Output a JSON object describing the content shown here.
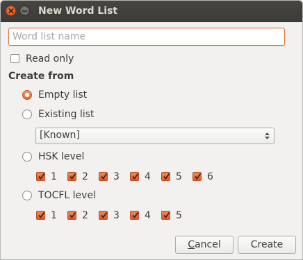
{
  "window": {
    "title": "New Word List"
  },
  "name_field": {
    "placeholder": "Word list name",
    "value": ""
  },
  "read_only": {
    "label": "Read only",
    "checked": false
  },
  "create_from": {
    "title": "Create from",
    "empty_list": {
      "label": "Empty list",
      "selected": true
    },
    "existing_list": {
      "label": "Existing list",
      "selected": false,
      "combo_value": "[Known]"
    },
    "hsk": {
      "label": "HSK level",
      "selected": false,
      "levels": [
        {
          "label": "1",
          "checked": true
        },
        {
          "label": "2",
          "checked": true
        },
        {
          "label": "3",
          "checked": true
        },
        {
          "label": "4",
          "checked": true
        },
        {
          "label": "5",
          "checked": true
        },
        {
          "label": "6",
          "checked": true
        }
      ]
    },
    "tocfl": {
      "label": "TOCFL level",
      "selected": false,
      "levels": [
        {
          "label": "1",
          "checked": true
        },
        {
          "label": "2",
          "checked": true
        },
        {
          "label": "3",
          "checked": true
        },
        {
          "label": "4",
          "checked": true
        },
        {
          "label": "5",
          "checked": true
        }
      ]
    }
  },
  "buttons": {
    "cancel_mnemonic": "C",
    "cancel_rest": "ancel",
    "create": "Create"
  },
  "colors": {
    "accent": "#e2703f",
    "titlebar": "#3c3b37",
    "background": "#f2f1f0"
  },
  "icons": {
    "close": "close-icon",
    "minimize": "minimize-icon",
    "combo": "up-down-arrows-icon",
    "check": "checkmark-icon"
  }
}
